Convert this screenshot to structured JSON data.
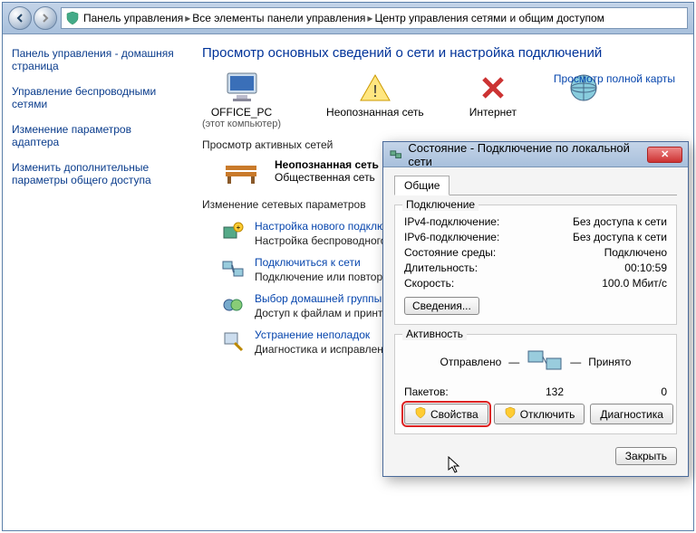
{
  "breadcrumb": {
    "part1": "Панель управления",
    "part2": "Все элементы панели управления",
    "part3": "Центр управления сетями и общим доступом"
  },
  "sidebar": {
    "items": [
      "Панель управления - домашняя страница",
      "Управление беспроводными сетями",
      "Изменение параметров адаптера",
      "Изменить дополнительные параметры общего доступа"
    ]
  },
  "page": {
    "title": "Просмотр основных сведений о сети и настройка подключений",
    "full_map_link": "Просмотр полной карты",
    "map_items": [
      {
        "label": "OFFICE_PC",
        "sublabel": "(этот компьютер)"
      },
      {
        "label": "Неопознанная сеть",
        "sublabel": ""
      },
      {
        "label": "Интернет",
        "sublabel": ""
      }
    ],
    "active_networks_header": "Просмотр активных сетей",
    "network_box": {
      "name": "Неопознанная сеть",
      "type": "Общественная сеть"
    },
    "change_params_header": "Изменение сетевых параметров",
    "params": [
      {
        "title": "Настройка нового подключени",
        "desc": "Настройка беспроводного, ши\nили же настройка маршрутиза"
      },
      {
        "title": "Подключиться к сети",
        "desc": "Подключение или повторное п\nсетевому соединению или под"
      },
      {
        "title": "Выбор домашней группы и пар",
        "desc": "Доступ к файлам и принтерам,\nизменение параметров общег"
      },
      {
        "title": "Устранение неполадок",
        "desc": "Диагностика и исправление се"
      }
    ]
  },
  "dialog": {
    "title": "Состояние - Подключение по локальной сети",
    "tab": "Общие",
    "connection_group": "Подключение",
    "conn": [
      {
        "k": "IPv4-подключение:",
        "v": "Без доступа к сети"
      },
      {
        "k": "IPv6-подключение:",
        "v": "Без доступа к сети"
      },
      {
        "k": "Состояние среды:",
        "v": "Подключено"
      },
      {
        "k": "Длительность:",
        "v": "00:10:59"
      },
      {
        "k": "Скорость:",
        "v": "100.0 Мбит/с"
      }
    ],
    "details_btn": "Сведения...",
    "activity_group": "Активность",
    "sent_label": "Отправлено",
    "recv_label": "Принято",
    "packets_label": "Пакетов:",
    "packets_sent": "132",
    "packets_recv": "0",
    "props_btn": "Свойства",
    "disable_btn": "Отключить",
    "diag_btn": "Диагностика",
    "close_btn": "Закрыть"
  }
}
